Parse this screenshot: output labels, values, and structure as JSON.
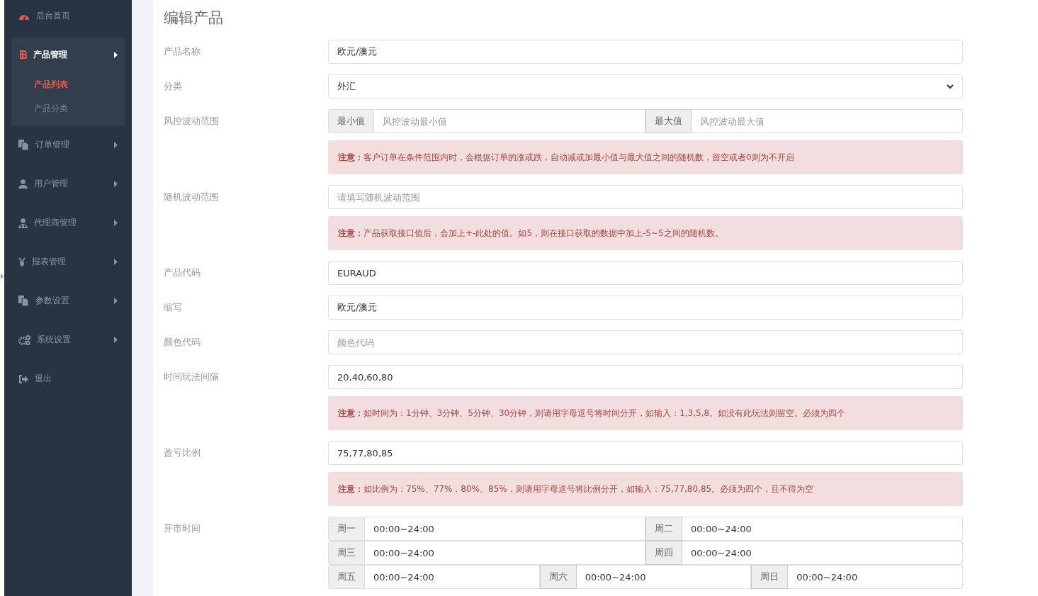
{
  "sidebar": {
    "items": [
      {
        "label": "后台首页",
        "has_submenu": false,
        "selected": false
      },
      {
        "label": "产品管理",
        "has_submenu": true,
        "selected": true,
        "children": [
          {
            "label": "产品列表",
            "selected": true
          },
          {
            "label": "产品分类",
            "selected": false
          }
        ]
      },
      {
        "label": "订单管理",
        "has_submenu": true,
        "selected": false
      },
      {
        "label": "用户管理",
        "has_submenu": true,
        "selected": false
      },
      {
        "label": "代理商管理",
        "has_submenu": true,
        "selected": false
      },
      {
        "label": "报表管理",
        "has_submenu": true,
        "selected": false
      },
      {
        "label": "参数设置",
        "has_submenu": true,
        "selected": false
      },
      {
        "label": "系统设置",
        "has_submenu": true,
        "selected": false
      },
      {
        "label": "退出",
        "has_submenu": false,
        "selected": false
      }
    ]
  },
  "form": {
    "title": "编辑产品",
    "rows": [
      {
        "label": "产品名称",
        "kind": "text",
        "value": "欧元/澳元"
      },
      {
        "label": "分类",
        "kind": "select",
        "value": "外汇"
      },
      {
        "label": "风控波动范围",
        "kind": "range",
        "parts": [
          {
            "addon": "最小值",
            "placeholder": "风控波动最小值"
          },
          {
            "addon": "最大值",
            "placeholder": "风控波动最大值"
          }
        ],
        "note": "**注意：** 客户订单在条件范围内时，会根据订单的涨或跌，自动减或加最小值与最大值之间的随机数，留空或者0则为不开启"
      },
      {
        "label": "随机波动范围",
        "kind": "text",
        "placeholder": "请填写随机波动范围",
        "note": "**注意：** 产品获取接口值后，会加上+-此处的值。如5，则在接口获取的数据中加上-5~5之间的随机数。"
      },
      {
        "label": "产品代码",
        "kind": "text",
        "value": "EURAUD"
      },
      {
        "label": "缩写",
        "kind": "text",
        "value": "欧元/澳元"
      },
      {
        "label": "颜色代码",
        "kind": "text",
        "placeholder": "颜色代码"
      },
      {
        "label": "时间玩法间隔",
        "kind": "text",
        "value": "20,40,60,80",
        "note": "**注意：** 如时间为：1分钟、3分钟、5分钟、30分钟，则请用字母逗号将时间分开，如输入：1,3,5,8。如没有此玩法则留空。必须为四个"
      },
      {
        "label": "盈亏比例",
        "kind": "text",
        "value": "75,77,80,85",
        "note": "**注意：** 如比例为：75%、77%，80%、85%，则请用字母逗号将比例分开，如输入：75,77,80,85。必须为四个，且不得为空"
      },
      {
        "label": "开市时间",
        "kind": "schedule",
        "groups": [
          [
            {
              "day": "周一",
              "value": "00:00~24:00"
            },
            {
              "day": "周二",
              "value": "00:00~24:00"
            }
          ],
          [
            {
              "day": "周三",
              "value": "00:00~24:00"
            },
            {
              "day": "周四",
              "value": "00:00~24:00"
            }
          ],
          [
            {
              "day": "周五",
              "value": "00:00~24:00"
            },
            {
              "day": "周六",
              "value": "00:00~24:00"
            },
            {
              "day": "周日",
              "value": "00:00~24:00"
            }
          ]
        ]
      }
    ]
  }
}
